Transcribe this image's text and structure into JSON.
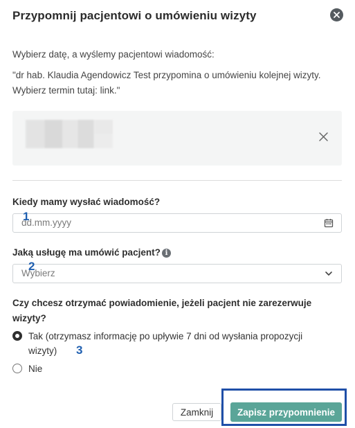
{
  "dialog": {
    "title": "Przypomnij pacjentowi o umówieniu wizyty",
    "intro": "Wybierz datę, a wyślemy pacjentowi wiadomość:",
    "message": "\"dr hab. Klaudia Agendowicz Test przypomina o umówieniu kolejnej wizyty. Wybierz termin tutaj: link.\""
  },
  "patient": {
    "remove_icon": "close-icon"
  },
  "date_field": {
    "label": "Kiedy mamy wysłać wiadomość?",
    "placeholder": "dd.mm.yyyy",
    "icon": "calendar-icon",
    "marker": "1"
  },
  "service_field": {
    "label": "Jaką usługę ma umówić pacjent?",
    "info_icon": "info-icon",
    "selected": "Wybierz",
    "icon": "chevron-down-icon",
    "marker": "2"
  },
  "notify": {
    "question": "Czy chcesz otrzymać powiadomienie, jeżeli pacjent nie zarezerwuje wizyty?",
    "options": [
      {
        "label": "Tak (otrzymasz informację po upływie 7 dni od wysłania propozycji wizyty)",
        "checked": true
      },
      {
        "label": "Nie",
        "checked": false
      }
    ],
    "marker": "3"
  },
  "footer": {
    "cancel_label": "Zamknij",
    "save_label": "Zapisz przypomnienie"
  },
  "colors": {
    "primary_button": "#5aa598",
    "annotation_blue": "#1f4fa8"
  }
}
